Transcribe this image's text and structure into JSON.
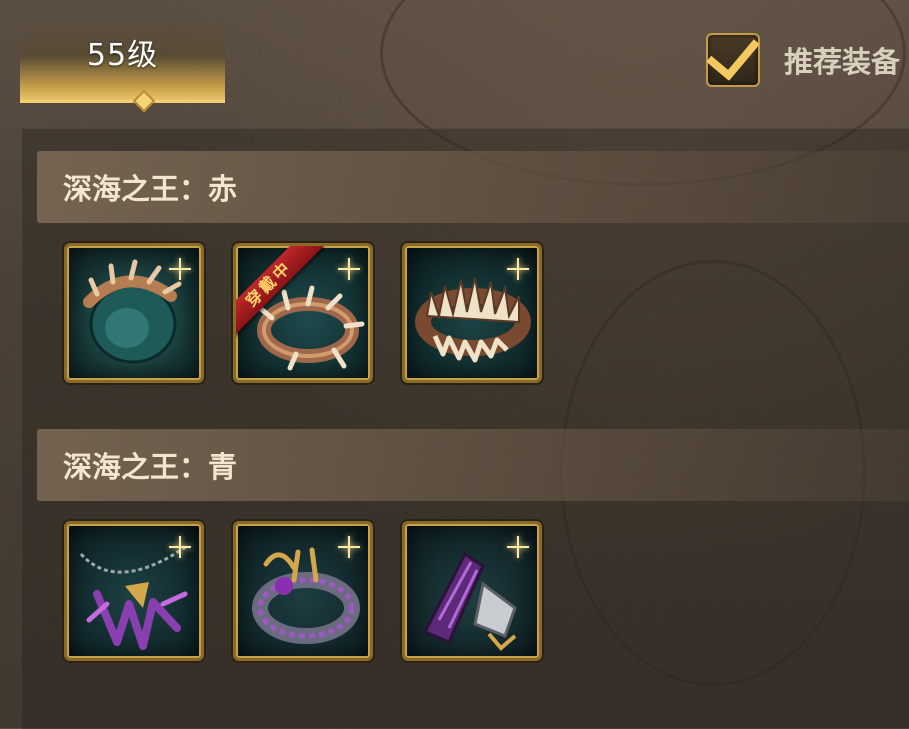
{
  "level_tab": {
    "label": "55级"
  },
  "recommend": {
    "label": "推荐装备",
    "checked": true
  },
  "sets": [
    {
      "title": "深海之王：赤",
      "items": [
        {
          "icon": "spiked-orb-ring-icon",
          "equipped": false
        },
        {
          "icon": "thorn-bracelet-icon",
          "equipped": true,
          "badge": "穿戴中"
        },
        {
          "icon": "fang-jaw-ring-icon",
          "equipped": false
        }
      ]
    },
    {
      "title": "深海之王：青",
      "items": [
        {
          "icon": "purple-claw-necklace-icon",
          "equipped": false
        },
        {
          "icon": "purple-spiked-ring-icon",
          "equipped": false
        },
        {
          "icon": "purple-horn-bracer-icon",
          "equipped": false
        }
      ]
    }
  ],
  "colors": {
    "gold_accent": "#e9c46a",
    "checkbox_mark": "#f4c960",
    "ribbon_red": "#c0282a",
    "item_teal": "#1f4a4a",
    "item_purple": "#7a3aa0"
  }
}
